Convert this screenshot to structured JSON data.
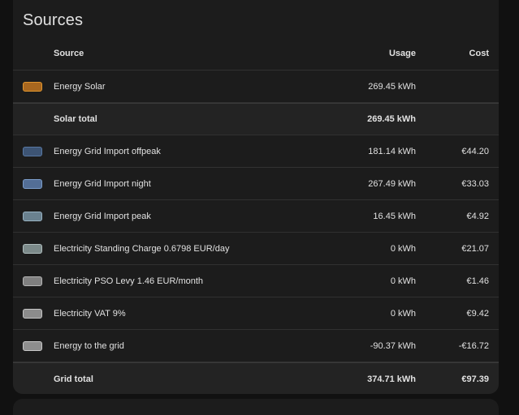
{
  "card": {
    "title": "Sources"
  },
  "table": {
    "headers": {
      "source": "Source",
      "usage": "Usage",
      "cost": "Cost"
    },
    "rows": [
      {
        "label": "Energy Solar",
        "usage": "269.45 kWh",
        "cost": "",
        "color_fill": "#a8671f",
        "color_border": "#e0962f"
      },
      {
        "label": "Solar total",
        "usage": "269.45 kWh",
        "cost": ""
      },
      {
        "label": "Energy Grid Import offpeak",
        "usage": "181.14 kWh",
        "cost": "€44.20",
        "color_fill": "#3d5474",
        "color_border": "#5878a3"
      },
      {
        "label": "Energy Grid Import night",
        "usage": "267.49 kWh",
        "cost": "€33.03",
        "color_fill": "#536e96",
        "color_border": "#7b9cc9"
      },
      {
        "label": "Energy Grid Import peak",
        "usage": "16.45 kWh",
        "cost": "€4.92",
        "color_fill": "#6a818f",
        "color_border": "#98b2c2"
      },
      {
        "label": "Electricity Standing Charge 0.6798 EUR/day",
        "usage": "0 kWh",
        "cost": "€21.07",
        "color_fill": "#7c8a8a",
        "color_border": "#aebcbc"
      },
      {
        "label": "Electricity PSO Levy 1.46 EUR/month",
        "usage": "0 kWh",
        "cost": "€1.46",
        "color_fill": "#808080",
        "color_border": "#b6b6b6"
      },
      {
        "label": "Electricity VAT 9%",
        "usage": "0 kWh",
        "cost": "€9.42",
        "color_fill": "#8c8c8c",
        "color_border": "#c4c4c4"
      },
      {
        "label": "Energy to the grid",
        "usage": "-90.37 kWh",
        "cost": "-€16.72",
        "color_fill": "#8e8e8e",
        "color_border": "#c8c8c8"
      },
      {
        "label": "Grid total",
        "usage": "374.71 kWh",
        "cost": "€97.39"
      }
    ]
  },
  "colors": {
    "background": "#111111",
    "card": "#1c1c1c",
    "text": "#e1e1e1",
    "divider": "#313131"
  }
}
